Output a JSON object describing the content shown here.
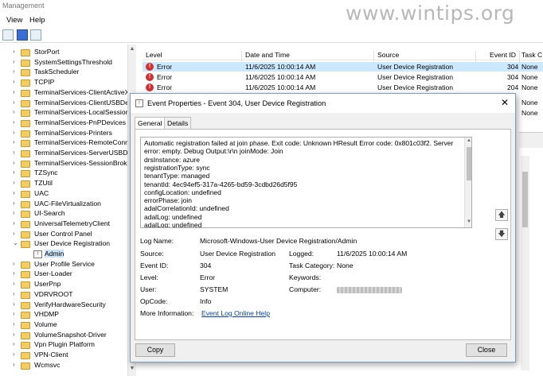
{
  "window": {
    "title": "Management"
  },
  "watermark": "www.wintips.org",
  "menu": [
    "View",
    "Help"
  ],
  "tree": {
    "items": [
      {
        "label": "StorPort",
        "selected": false
      },
      {
        "label": "SystemSettingsThreshold",
        "selected": false
      },
      {
        "label": "TaskScheduler",
        "selected": false
      },
      {
        "label": "TCPIP",
        "selected": false
      },
      {
        "label": "TerminalServices-ClientActiveX",
        "selected": false
      },
      {
        "label": "TerminalServices-ClientUSBDev",
        "selected": false
      },
      {
        "label": "TerminalServices-LocalSession",
        "selected": false
      },
      {
        "label": "TerminalServices-PnPDevices",
        "selected": false
      },
      {
        "label": "TerminalServices-Printers",
        "selected": false
      },
      {
        "label": "TerminalServices-RemoteConne",
        "selected": false
      },
      {
        "label": "TerminalServices-ServerUSBDev",
        "selected": false
      },
      {
        "label": "TerminalServices-SessionBroker",
        "selected": false
      },
      {
        "label": "TZSync",
        "selected": false
      },
      {
        "label": "TZUtil",
        "selected": false
      },
      {
        "label": "UAC",
        "selected": false
      },
      {
        "label": "UAC-FileVirtualization",
        "selected": false
      },
      {
        "label": "UI-Search",
        "selected": false
      },
      {
        "label": "UniversalTelemetryClient",
        "selected": false
      },
      {
        "label": "User Control Panel",
        "selected": false
      },
      {
        "label": "User Device Registration",
        "selected": false,
        "expanded": true
      },
      {
        "label": "Admin",
        "selected": true,
        "child": true
      },
      {
        "label": "User Profile Service",
        "selected": false
      },
      {
        "label": "User-Loader",
        "selected": false
      },
      {
        "label": "UserPnp",
        "selected": false
      },
      {
        "label": "VDRVROOT",
        "selected": false
      },
      {
        "label": "VerifyHardwareSecurity",
        "selected": false
      },
      {
        "label": "VHDMP",
        "selected": false
      },
      {
        "label": "Volume",
        "selected": false
      },
      {
        "label": "VolumeSnapshot-Driver",
        "selected": false
      },
      {
        "label": "Vpn Plugin Platform",
        "selected": false
      },
      {
        "label": "VPN-Client",
        "selected": false
      },
      {
        "label": "Wcmsvc",
        "selected": false
      }
    ]
  },
  "events": {
    "columns": [
      "Level",
      "Date and Time",
      "Source",
      "Event ID",
      "Task C"
    ],
    "rows": [
      {
        "level": "Error",
        "date": "11/6/2025 10:00:14 AM",
        "source": "User Device Registration",
        "id": "304",
        "task": "None",
        "selected": true
      },
      {
        "level": "Error",
        "date": "11/6/2025 10:00:14 AM",
        "source": "User Device Registration",
        "id": "304",
        "task": "None",
        "selected": false
      },
      {
        "level": "Error",
        "date": "11/6/2025 10:00:14 AM",
        "source": "User Device Registration",
        "id": "204",
        "task": "None",
        "selected": false
      }
    ],
    "extra_task": [
      "None",
      "None"
    ]
  },
  "dialog": {
    "title": "Event Properties - Event 304, User Device Registration",
    "tabs": [
      "General",
      "Details"
    ],
    "message_lines": [
      "Automatic registration failed at join phase.  Exit code: Unknown HResult Error code: 0x801c03f2. Server",
      "error: empty. Debug Output:\\r\\n joinMode: Join",
      "drsInstance: azure",
      "registrationType: sync",
      "tenantType: managed",
      "tenantId: 4ec94ef5-317a-4265-bd59-3cdbd26d5f95",
      "configLocation: undefined",
      "errorPhase: join",
      "adalCorrelationId: undefined",
      "adalLog: undefined",
      "adalLog: undefined"
    ],
    "fields": {
      "log_name_label": "Log Name:",
      "log_name": "Microsoft-Windows-User Device Registration/Admin",
      "source_label": "Source:",
      "source": "User Device Registration",
      "logged_label": "Logged:",
      "logged": "11/6/2025 10:00:14 AM",
      "event_id_label": "Event ID:",
      "event_id": "304",
      "task_label": "Task Category:",
      "task": "None",
      "level_label": "Level:",
      "level": "Error",
      "keywords_label": "Keywords:",
      "keywords": "",
      "user_label": "User:",
      "user": "SYSTEM",
      "computer_label": "Computer:",
      "opcode_label": "OpCode:",
      "opcode": "Info",
      "more_info_label": "More Information:",
      "more_info_link": "Event Log Online Help"
    },
    "copy_label": "Copy",
    "close_label": "Close",
    "close_glyph": "✕",
    "up_glyph": "🡅",
    "down_glyph": "🡇"
  }
}
